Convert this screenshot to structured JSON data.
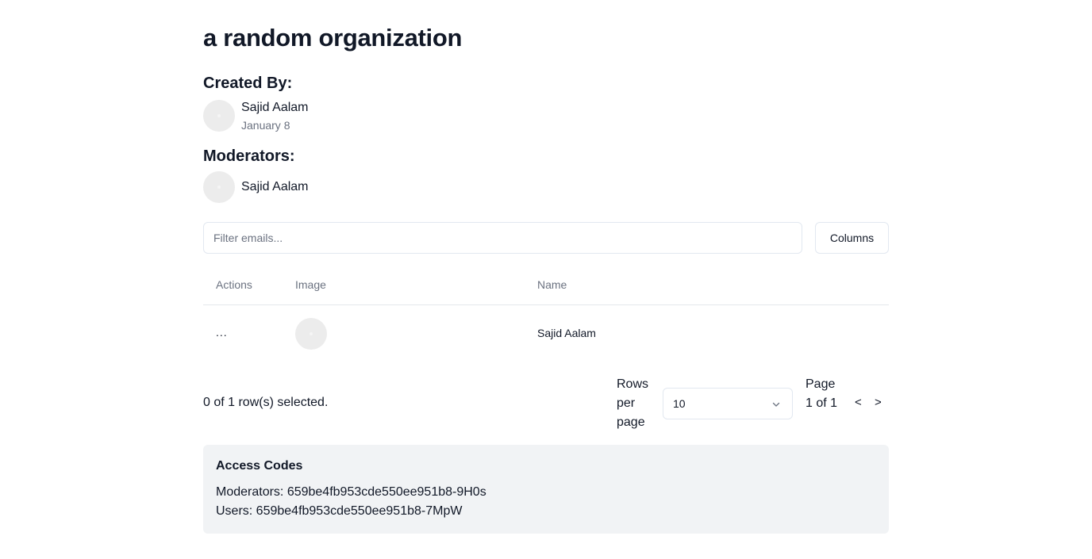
{
  "organization": {
    "title": "a random organization"
  },
  "created_by": {
    "label": "Created By:",
    "name": "Sajid Aalam",
    "date": "January 8"
  },
  "moderators": {
    "label": "Moderators:",
    "items": [
      {
        "name": "Sajid Aalam"
      }
    ]
  },
  "toolbar": {
    "filter_placeholder": "Filter emails...",
    "filter_value": "",
    "columns_label": "Columns"
  },
  "table": {
    "headers": [
      "Actions",
      "Image",
      "Name"
    ],
    "rows": [
      {
        "actions": "...",
        "name": "Sajid Aalam"
      }
    ]
  },
  "footer": {
    "selected_text": "0 of 1 row(s) selected.",
    "rows_per_page_label": "Rows per page",
    "rows_per_page_value": "10",
    "page_label": "Page 1 of 1",
    "prev_label": "<",
    "next_label": ">"
  },
  "access_codes": {
    "title": "Access Codes",
    "moderators_line": "Moderators: 659be4fb953cde550ee951b8-9H0s",
    "users_line": "Users: 659be4fb953cde550ee951b8-7MpW"
  }
}
